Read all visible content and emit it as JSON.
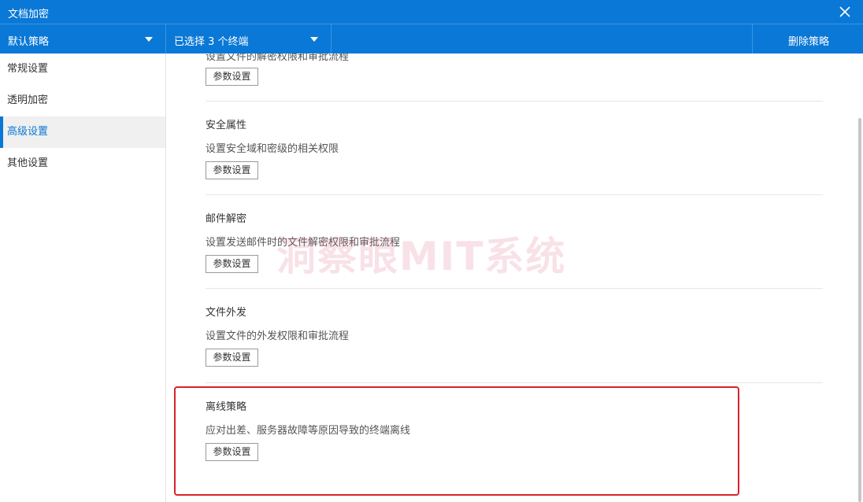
{
  "window": {
    "title": "文档加密"
  },
  "toolbar": {
    "policy_select": "默认策略",
    "terminal_select": "已选择 3 个终端",
    "delete_button": "删除策略"
  },
  "sidebar": {
    "items": [
      {
        "label": "常规设置",
        "active": false
      },
      {
        "label": "透明加密",
        "active": false
      },
      {
        "label": "高级设置",
        "active": true
      },
      {
        "label": "其他设置",
        "active": false
      }
    ]
  },
  "content": {
    "partial_section_desc": "设置文件的解密权限和审批流程",
    "sections": [
      {
        "title": "安全属性",
        "desc": "设置安全域和密级的相关权限",
        "button": "参数设置"
      },
      {
        "title": "邮件解密",
        "desc": "设置发送邮件时的文件解密权限和审批流程",
        "button": "参数设置"
      },
      {
        "title": "文件外发",
        "desc": "设置文件的外发权限和审批流程",
        "button": "参数设置"
      },
      {
        "title": "离线策略",
        "desc": "应对出差、服务器故障等原因导致的终端离线",
        "button": "参数设置"
      }
    ],
    "partial_button": "参数设置",
    "watermark": "洞察眼MIT系统"
  },
  "colors": {
    "accent": "#0a78d6",
    "highlight_border": "#d8232a"
  }
}
